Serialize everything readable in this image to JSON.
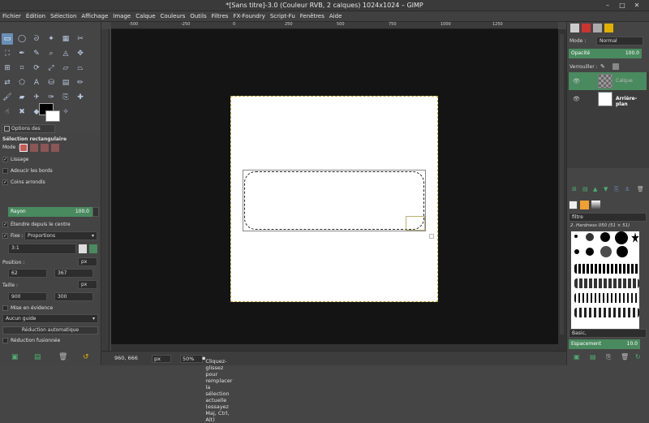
{
  "window": {
    "title": "*[Sans titre]-3.0 (Couleur RVB, 2 calques) 1024x1024 – GIMP",
    "controls": [
      "–",
      "□",
      "✕"
    ]
  },
  "menu": [
    "Fichier",
    "Édition",
    "Sélection",
    "Affichage",
    "Image",
    "Calque",
    "Couleurs",
    "Outils",
    "Filtres",
    "FX-Foundry",
    "Script-Fu",
    "Fenêtres",
    "Aide"
  ],
  "tool_options": {
    "tab_label": "Options des outils",
    "title": "Sélection rectangulaire",
    "mode_label": "Mode :",
    "antialiasing": "Lissage",
    "feather": "Adoucir les bords",
    "rounded": "Coins arrondis",
    "radius_label": "Rayon",
    "radius_value": "100.0",
    "expand_center": "Étendre depuis le centre",
    "fixed_label": "Fixe :",
    "fixed_value": "Proportions",
    "ratio": "3:1",
    "position_label": "Position :",
    "position_unit": "px",
    "pos_x": "62",
    "pos_y": "367",
    "size_label": "Taille :",
    "size_unit": "px",
    "size_w": "900",
    "size_h": "300",
    "highlight": "Mise en évidence",
    "guides": "Aucun guide",
    "auto_shrink": "Réduction automatique",
    "shrink_merged": "Réduction fusionnée"
  },
  "ruler": {
    "labels": [
      "-500",
      "-250",
      "0",
      "250",
      "500",
      "750",
      "1000",
      "1250"
    ]
  },
  "status": {
    "coords": "960, 666",
    "unit": "px",
    "zoom": "50%",
    "message": "Cliquez-glissez pour remplacer la sélection actuelle (essayez Maj, Ctrl, Alt)"
  },
  "layers": {
    "mode_label": "Mode :",
    "mode_value": "Normal",
    "opacity_label": "Opacité",
    "opacity_value": "100.0",
    "lock_label": "Verrouiller :",
    "items": [
      {
        "name": "Calque"
      },
      {
        "name": "Arrière-plan"
      }
    ]
  },
  "brushes": {
    "filter_placeholder": "filtre",
    "current": "2. Hardness 050 (51 × 51)",
    "preset": "Basic,",
    "spacing_label": "Espacement",
    "spacing_value": "10.0"
  },
  "colors": {
    "accent_green": "#4a8a5f",
    "selection_blue": "#6a8fb8",
    "canvas_bg": "#141414"
  }
}
